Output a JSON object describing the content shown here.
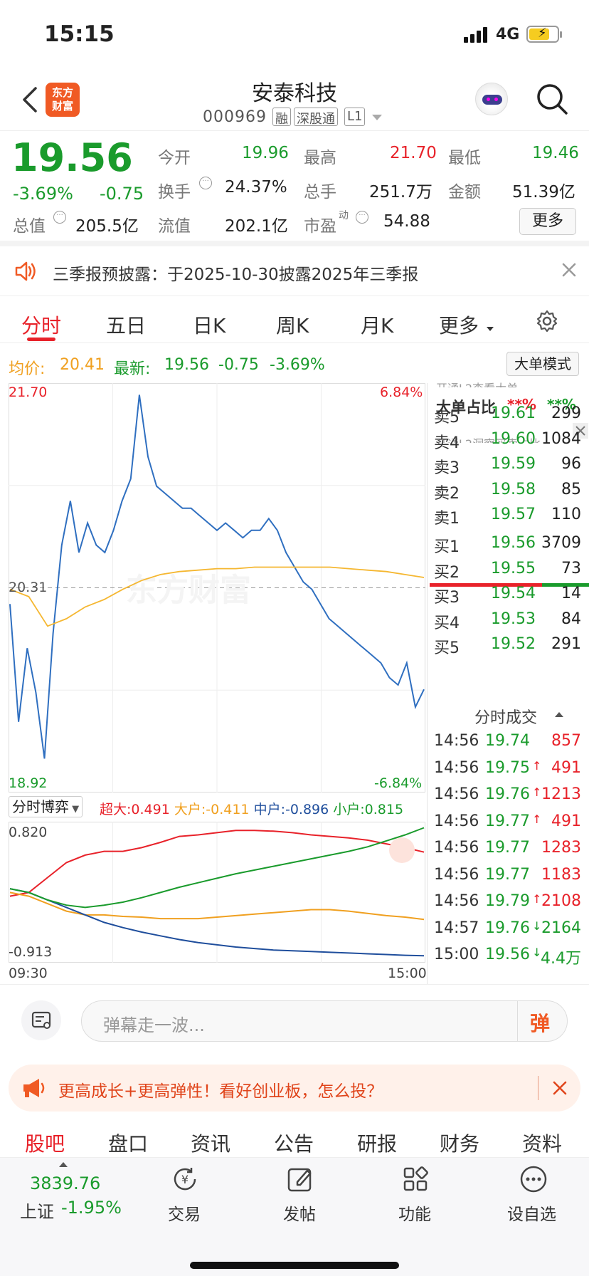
{
  "status_bar": {
    "time": "15:15",
    "network": "4G"
  },
  "header": {
    "title": "安泰科技",
    "code": "000969",
    "tags": [
      "融",
      "深股通",
      "L1"
    ],
    "brand": "东方财富"
  },
  "quote": {
    "price": "19.56",
    "pct": "-3.69%",
    "chg": "-0.75",
    "stats": [
      {
        "label": "今开",
        "value": "19.96",
        "color": "green"
      },
      {
        "label": "最高",
        "value": "21.70",
        "color": "red"
      },
      {
        "label": "最低",
        "value": "19.46",
        "color": "green"
      },
      {
        "label": "换手",
        "value": "24.37%",
        "color": "dark"
      },
      {
        "label": "总手",
        "value": "251.7万",
        "color": "dark"
      },
      {
        "label": "金额",
        "value": "51.39亿",
        "color": "dark"
      },
      {
        "label": "总值",
        "value": "205.5亿",
        "color": "dark"
      },
      {
        "label": "流值",
        "value": "202.1亿",
        "color": "dark"
      },
      {
        "label": "市盈",
        "value": "54.88",
        "color": "dark"
      }
    ],
    "pe_sup": "动",
    "more_button": "更多"
  },
  "notice": {
    "text": "三季报预披露：于2025-10-30披露2025年三季报"
  },
  "tabs": [
    "分时",
    "五日",
    "日K",
    "周K",
    "月K",
    "更多"
  ],
  "info_line": {
    "avg_label": "均价:",
    "avg_value": "20.41",
    "latest_label": "最新:",
    "latest_value": "19.56",
    "chg": "-0.75",
    "pct": "-3.69%",
    "mode_button": "大单模式"
  },
  "chart_data": [
    {
      "type": "line",
      "y_ticks_left": [
        "21.70",
        "20.31",
        "18.92"
      ],
      "y_ticks_right": [
        "6.84%",
        "-6.84%"
      ],
      "ylim": [
        18.92,
        21.7
      ],
      "series": [
        {
          "name": "",
          "color": "#2f6fc0",
          "values": [
            20.2,
            19.4,
            19.9,
            19.6,
            19.15,
            20.0,
            20.6,
            20.9,
            20.55,
            20.75,
            20.6,
            20.55,
            20.7,
            20.9,
            21.05,
            21.62,
            21.2,
            21.0,
            20.95,
            20.9,
            20.85,
            20.85,
            20.8,
            20.75,
            20.7,
            20.75,
            20.7,
            20.65,
            20.7,
            20.7,
            20.78,
            20.7,
            20.55,
            20.45,
            20.35,
            20.3,
            20.2,
            20.1,
            20.05,
            20.0,
            19.95,
            19.9,
            19.85,
            19.8,
            19.7,
            19.65,
            19.8,
            19.5,
            19.62
          ]
        },
        {
          "name": "",
          "color": "#f5b731",
          "values": [
            20.3,
            20.25,
            20.05,
            20.1,
            20.18,
            20.23,
            20.3,
            20.36,
            20.4,
            20.42,
            20.43,
            20.44,
            20.44,
            20.45,
            20.45,
            20.45,
            20.45,
            20.45,
            20.44,
            20.43,
            20.42,
            20.4,
            20.38
          ]
        }
      ],
      "x_ticks": [
        "09:30",
        "15:00"
      ]
    },
    {
      "type": "line",
      "title": "分时博弈",
      "legend": [
        {
          "label": "超大:",
          "value": "0.491",
          "color": "#e8222a"
        },
        {
          "label": "大户:",
          "value": "-0.411",
          "color": "#f0a020"
        },
        {
          "label": "中户:",
          "value": "-0.896",
          "color": "#1f4e9c"
        },
        {
          "label": "小户:",
          "value": "0.815",
          "color": "#1a9b2c"
        }
      ],
      "y_ticks": [
        "0.820",
        "-0.913"
      ],
      "ylim": [
        -0.913,
        0.82
      ],
      "series": [
        {
          "name": "超大",
          "color": "#e8222a",
          "values": [
            -0.1,
            -0.05,
            0.15,
            0.35,
            0.45,
            0.5,
            0.5,
            0.55,
            0.62,
            0.7,
            0.72,
            0.75,
            0.78,
            0.78,
            0.77,
            0.75,
            0.72,
            0.7,
            0.68,
            0.65,
            0.6,
            0.55,
            0.49
          ]
        },
        {
          "name": "大户",
          "color": "#f0a020",
          "values": [
            -0.05,
            -0.1,
            -0.2,
            -0.3,
            -0.35,
            -0.35,
            -0.37,
            -0.38,
            -0.4,
            -0.4,
            -0.4,
            -0.38,
            -0.36,
            -0.34,
            -0.32,
            -0.3,
            -0.28,
            -0.28,
            -0.3,
            -0.33,
            -0.36,
            -0.38,
            -0.41
          ]
        },
        {
          "name": "中户",
          "color": "#1f4e9c",
          "values": [
            0.0,
            -0.05,
            -0.15,
            -0.25,
            -0.35,
            -0.45,
            -0.52,
            -0.58,
            -0.63,
            -0.68,
            -0.72,
            -0.75,
            -0.78,
            -0.8,
            -0.82,
            -0.83,
            -0.84,
            -0.85,
            -0.86,
            -0.87,
            -0.88,
            -0.89,
            -0.896
          ]
        },
        {
          "name": "小户",
          "color": "#1a9b2c",
          "values": [
            0.0,
            -0.05,
            -0.15,
            -0.22,
            -0.25,
            -0.22,
            -0.18,
            -0.12,
            -0.05,
            0.02,
            0.08,
            0.14,
            0.2,
            0.25,
            0.3,
            0.35,
            0.4,
            0.45,
            0.5,
            0.56,
            0.64,
            0.72,
            0.815
          ]
        }
      ]
    }
  ],
  "side_panel": {
    "top_partial": "开通L2查看大单",
    "big_ratio_label": "大单占比",
    "big_ratio_v1": "**%",
    "big_ratio_v2": "**%",
    "l2_link": "开通L2洞察买卖占比",
    "sell": [
      {
        "label": "卖5",
        "price": "19.61",
        "vol": "299"
      },
      {
        "label": "卖4",
        "price": "19.60",
        "vol": "1084"
      },
      {
        "label": "卖3",
        "price": "19.59",
        "vol": "96"
      },
      {
        "label": "卖2",
        "price": "19.58",
        "vol": "85"
      },
      {
        "label": "卖1",
        "price": "19.57",
        "vol": "110"
      }
    ],
    "buy": [
      {
        "label": "买1",
        "price": "19.56",
        "vol": "3709"
      },
      {
        "label": "买2",
        "price": "19.55",
        "vol": "73"
      },
      {
        "label": "买3",
        "price": "19.54",
        "vol": "14"
      },
      {
        "label": "买4",
        "price": "19.53",
        "vol": "84"
      },
      {
        "label": "买5",
        "price": "19.52",
        "vol": "291"
      }
    ],
    "ticks_title": "分时成交",
    "ticks": [
      {
        "time": "14:56",
        "price": "19.74",
        "arrow": "",
        "vol": "857",
        "vc": "red"
      },
      {
        "time": "14:56",
        "price": "19.75",
        "arrow": "↑",
        "vol": "491",
        "vc": "red"
      },
      {
        "time": "14:56",
        "price": "19.76",
        "arrow": "↑",
        "vol": "1213",
        "vc": "red"
      },
      {
        "time": "14:56",
        "price": "19.77",
        "arrow": "↑",
        "vol": "491",
        "vc": "red"
      },
      {
        "time": "14:56",
        "price": "19.77",
        "arrow": "",
        "vol": "1283",
        "vc": "red"
      },
      {
        "time": "14:56",
        "price": "19.77",
        "arrow": "",
        "vol": "1183",
        "vc": "red"
      },
      {
        "time": "14:56",
        "price": "19.79",
        "arrow": "↑",
        "vol": "2108",
        "vc": "red"
      },
      {
        "time": "14:57",
        "price": "19.76",
        "arrow": "↓",
        "vol": "2164",
        "vc": "green"
      },
      {
        "time": "15:00",
        "price": "19.56",
        "arrow": "↓",
        "vol": "4.4万",
        "vc": "green"
      }
    ]
  },
  "comment_bar": {
    "placeholder": "弹幕走一波...",
    "send_label": "弹"
  },
  "ad": {
    "text": "更高成长+更高弹性！看好创业板，怎么投？"
  },
  "section_tabs": [
    "股吧",
    "盘口",
    "资讯",
    "公告",
    "研报",
    "财务",
    "资料"
  ],
  "bottom_nav": {
    "index_value": "3839.76",
    "index_name": "上证",
    "index_pct": "-1.95%",
    "items": [
      "交易",
      "发帖",
      "功能",
      "设自选"
    ]
  }
}
